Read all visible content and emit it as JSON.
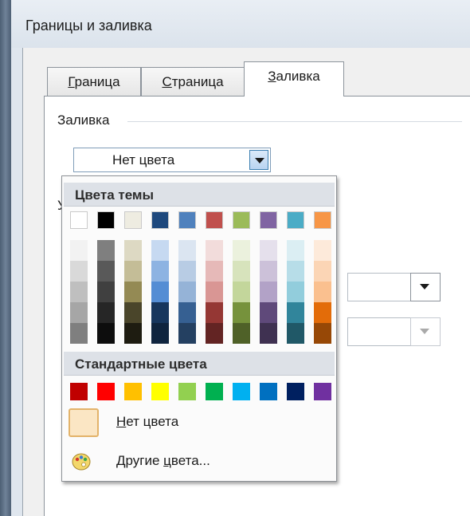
{
  "dialog": {
    "title": "Границы и заливка"
  },
  "tabs": [
    {
      "label": "Граница",
      "mnemonic": "Г",
      "rest": "раница"
    },
    {
      "label": "Страница",
      "mnemonic": "С",
      "rest": "траница"
    },
    {
      "label": "Заливка",
      "mnemonic": "З",
      "rest": "аливка"
    }
  ],
  "fill": {
    "section_label": "Заливка",
    "selected_value": "Нет цвета"
  },
  "pattern": {
    "section_label_partial": "Уз"
  },
  "color_popup": {
    "theme_header": "Цвета темы",
    "standard_header": "Стандартные цвета",
    "no_color_label": "Нет цвета",
    "no_color_mnemonic": "Н",
    "no_color_rest": "ет цвета",
    "more_colors_label": "Другие цвета...",
    "more_colors_prefix": "Другие ",
    "more_colors_mnemonic": "ц",
    "more_colors_rest": "вета...",
    "theme_colors": [
      {
        "name": "white",
        "base": "#ffffff",
        "shades": [
          "#f2f2f2",
          "#d9d9d9",
          "#bfbfbf",
          "#a6a6a6",
          "#7f7f7f"
        ]
      },
      {
        "name": "black",
        "base": "#000000",
        "shades": [
          "#7f7f7f",
          "#595959",
          "#404040",
          "#262626",
          "#0d0d0d"
        ]
      },
      {
        "name": "tan",
        "base": "#eeece1",
        "shades": [
          "#ddd9c3",
          "#c4bd97",
          "#948a54",
          "#4a452a",
          "#1e1c11"
        ]
      },
      {
        "name": "dark-blue",
        "base": "#1f497d",
        "shades": [
          "#c6d9f1",
          "#8db3e2",
          "#548dd4",
          "#17365d",
          "#0f243e"
        ]
      },
      {
        "name": "blue",
        "base": "#4f81bd",
        "shades": [
          "#dbe5f1",
          "#b8cce4",
          "#95b3d7",
          "#366092",
          "#244061"
        ]
      },
      {
        "name": "red",
        "base": "#c0504d",
        "shades": [
          "#f2dcdb",
          "#e6b9b8",
          "#d99694",
          "#953734",
          "#632423"
        ]
      },
      {
        "name": "olive-green",
        "base": "#9bbb59",
        "shades": [
          "#ebf1dd",
          "#d7e3bc",
          "#c3d69b",
          "#76923c",
          "#4f6128"
        ]
      },
      {
        "name": "purple",
        "base": "#8064a2",
        "shades": [
          "#e5e0ec",
          "#ccc1d9",
          "#b2a2c7",
          "#5f497a",
          "#3f3151"
        ]
      },
      {
        "name": "aqua",
        "base": "#4bacc6",
        "shades": [
          "#dbeef3",
          "#b7dde8",
          "#92cddc",
          "#31859b",
          "#205867"
        ]
      },
      {
        "name": "orange",
        "base": "#f79646",
        "shades": [
          "#fdeada",
          "#fbd5b5",
          "#fac08f",
          "#e36c09",
          "#974806"
        ]
      }
    ],
    "standard_colors": [
      "#c00000",
      "#ff0000",
      "#ffc000",
      "#ffff00",
      "#92d050",
      "#00b050",
      "#00b0f0",
      "#0070c0",
      "#002060",
      "#7030a0"
    ]
  }
}
